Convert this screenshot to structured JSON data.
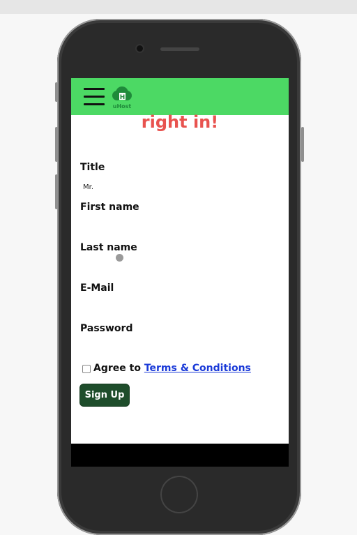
{
  "page": {
    "heading": "right in!",
    "form": {
      "title_label": "Title",
      "title_value": "Mr.",
      "first_name_label": "First name",
      "last_name_label": "Last name",
      "email_label": "E-Mail",
      "password_label": "Password",
      "agree_text": "Agree to",
      "terms_link": "Terms & Conditions",
      "signup_button": "Sign Up"
    },
    "logo_text": "uHost"
  },
  "colors": {
    "navbar": "#4cd964",
    "heading": "#e8534f",
    "button": "#1e4d2b",
    "link": "#1a3ad8"
  },
  "icons": {
    "menu": "hamburger-icon",
    "logo": "tree-logo-icon"
  }
}
